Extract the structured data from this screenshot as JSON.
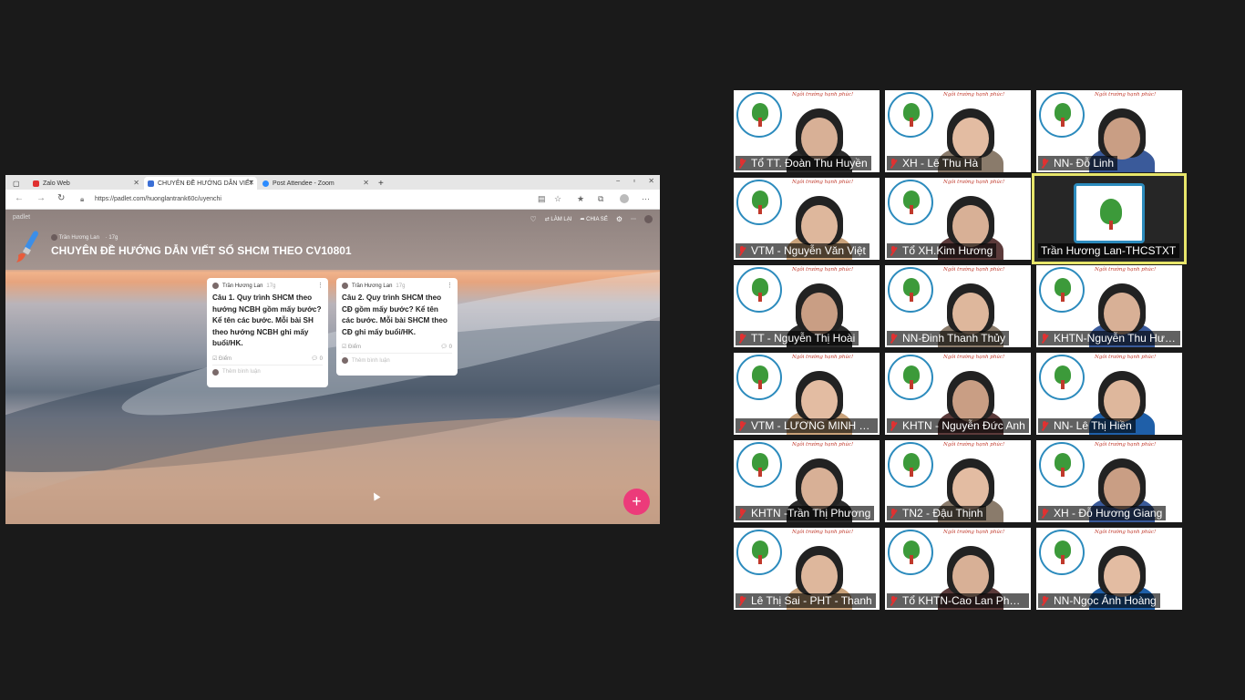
{
  "browser": {
    "tabs": [
      {
        "label": "Zalo Web",
        "color": "#e03131"
      },
      {
        "label": "CHUYÊN ĐỀ HƯỚNG DẪN VIẾT",
        "color": "#3b6fd6"
      },
      {
        "label": "Post Attendee - Zoom",
        "color": "#2d8cff"
      }
    ],
    "url": "https://padlet.com/huonglantrank60c/uyenchi"
  },
  "padlet": {
    "brand": "padlet",
    "author": "Trần Hương Lan",
    "age": "17g",
    "title": "CHUYÊN ĐỀ HƯỚNG DẪN VIẾT SỐ SHCM THEO CV10801",
    "actions": {
      "remake": "LÀM LẠI",
      "share": "CHIA SẺ"
    },
    "add_label": "+",
    "posts": [
      {
        "author": "Trần Hương Lan",
        "age": "17g",
        "text": "Câu 1. Quy trình SHCM theo hướng NCBH gồm mấy bước? Kể tên các bước. Mỗi bài SH theo hướng NCBH ghi mấy buổi/HK.",
        "grade": "Điểm",
        "comments": "0",
        "comment_placeholder": "Thêm bình luận"
      },
      {
        "author": "Trần Hương Lan",
        "age": "17g",
        "text": "Câu 2. Quy trình SHCM theo CĐ gồm mấy bước? Kể tên các bước. Mỗi bài SHCM theo CĐ ghi mấy buổi/HK.",
        "grade": "Điểm",
        "comments": "0",
        "comment_placeholder": "Thêm bình luận"
      }
    ]
  },
  "gallery": {
    "slogan": "Ngôi trường hạnh phúc!",
    "participants": [
      {
        "name": "Tổ TT. Đoàn Thu Huyền",
        "muted": true
      },
      {
        "name": "XH - Lê Thu Hà",
        "muted": true
      },
      {
        "name": "NN- Đỗ Linh",
        "muted": true
      },
      {
        "name": "VTM - Nguyễn Văn Việt",
        "muted": true
      },
      {
        "name": "Tổ XH.Kim Hương",
        "muted": true
      },
      {
        "name": "Trần Hương Lan-THCSTXT",
        "muted": false,
        "active": true
      },
      {
        "name": "TT - Nguyễn Thị Hoài",
        "muted": true
      },
      {
        "name": "NN-Đinh Thanh Thủy",
        "muted": true
      },
      {
        "name": "KHTN-Nguyễn Thu Hương",
        "muted": true
      },
      {
        "name": "VTM - LƯƠNG MINH TUẤN",
        "muted": true
      },
      {
        "name": "KHTN - Nguyễn Đức Anh",
        "muted": true
      },
      {
        "name": "NN- Lê Thị Hiền",
        "muted": true
      },
      {
        "name": "KHTN -Trần Thị Phương",
        "muted": true
      },
      {
        "name": "TN2 - Đậu Thịnh",
        "muted": true
      },
      {
        "name": "XH - Đỗ Hương Giang",
        "muted": true
      },
      {
        "name": "Lê Thị Sai - PHT - Thanh",
        "muted": true
      },
      {
        "name": "Tổ KHTN-Cao Lan Phương",
        "muted": true
      },
      {
        "name": "NN-Ngọc Ánh Hoàng",
        "muted": true
      }
    ]
  },
  "colors": {
    "accent_pink": "#ec3b7a",
    "active_border": "#e7e56a",
    "muted_red": "#e03131",
    "logo_blue": "#2c8bbd"
  }
}
